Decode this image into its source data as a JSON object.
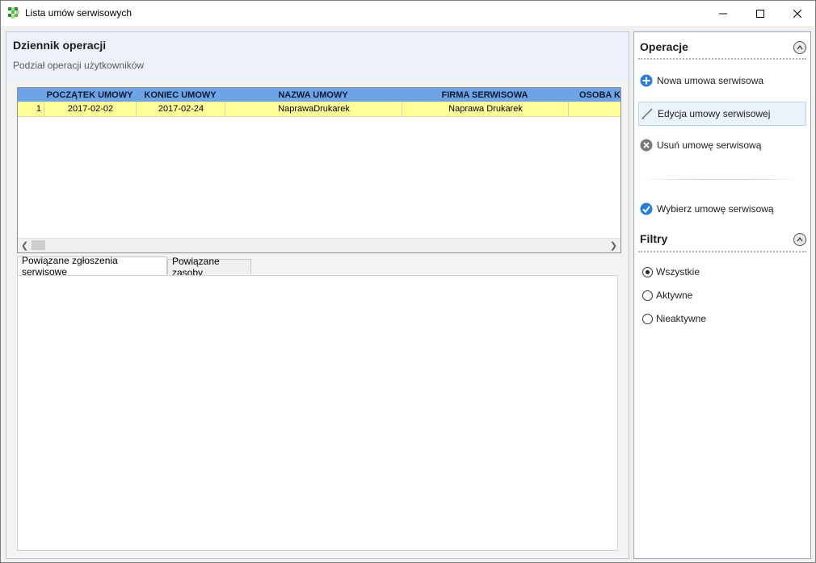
{
  "window": {
    "title": "Lista umów serwisowych"
  },
  "header": {
    "title": "Dziennik operacji",
    "subtitle": "Podział operacji użytkowników"
  },
  "grid": {
    "columns": [
      "",
      "POCZĄTEK UMOWY",
      "KONIEC UMOWY",
      "NAZWA UMOWY",
      "FIRMA SERWISOWA",
      "OSOBA K"
    ],
    "rows": [
      {
        "index": "1",
        "start": "2017-02-02",
        "end": "2017-02-24",
        "name": "NaprawaDrukarek",
        "company": "Naprawa Drukarek",
        "person": ""
      }
    ],
    "row_highlight_color": "#ffff99",
    "header_color": "#6fa3e8"
  },
  "tabs": [
    {
      "label": "Powiązane zgłoszenia serwisowe",
      "active": true
    },
    {
      "label": "Powiązane zasoby",
      "active": false
    }
  ],
  "operations": {
    "title": "Operacje",
    "items": [
      {
        "label": "Nowa umowa serwisowa",
        "icon": "plus-circle-icon"
      },
      {
        "label": "Edycja umowy serwisowej",
        "icon": "pencil-icon"
      },
      {
        "label": "Usuń umowę serwisową",
        "icon": "delete-circle-icon"
      },
      {
        "label": "Wybierz umowę serwisową",
        "icon": "check-circle-icon"
      }
    ]
  },
  "filters": {
    "title": "Filtry",
    "options": [
      {
        "label": "Wszystkie",
        "checked": true
      },
      {
        "label": "Aktywne",
        "checked": false
      },
      {
        "label": "Nieaktywne",
        "checked": false
      }
    ]
  }
}
